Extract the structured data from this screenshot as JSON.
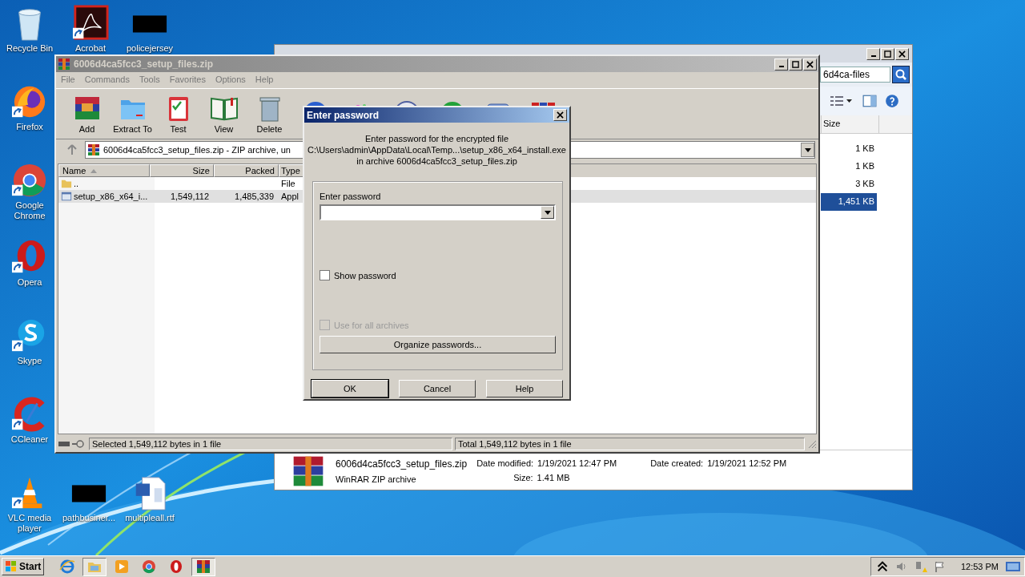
{
  "desktop": {
    "icons": [
      {
        "label": "Recycle Bin",
        "kind": "recycle",
        "shortcut": false
      },
      {
        "label": "Acrobat",
        "kind": "acrobat",
        "shortcut": true
      },
      {
        "label": "policejersey",
        "kind": "blank",
        "shortcut": false
      },
      {
        "label": "Firefox",
        "kind": "firefox",
        "shortcut": true
      },
      {
        "label": "Google Chrome",
        "kind": "chrome",
        "shortcut": true
      },
      {
        "label": "Opera",
        "kind": "opera",
        "shortcut": true
      },
      {
        "label": "Skype",
        "kind": "skype",
        "shortcut": true
      },
      {
        "label": "CCleaner",
        "kind": "ccleaner",
        "shortcut": true
      },
      {
        "label": "VLC media player",
        "kind": "vlc",
        "shortcut": true
      },
      {
        "label": "pathbusiner...",
        "kind": "blank",
        "shortcut": false
      },
      {
        "label": "multipleall.rtf",
        "kind": "word",
        "shortcut": false
      }
    ]
  },
  "explorer": {
    "search": {
      "value": "6d4ca-files"
    },
    "columns": [
      "Size"
    ],
    "rows": [
      {
        "size": "1 KB",
        "selected": false
      },
      {
        "size": "1 KB",
        "selected": false
      },
      {
        "size": "3 KB",
        "selected": false
      },
      {
        "size": "1,451 KB",
        "selected": true
      }
    ],
    "details": {
      "name": "6006d4ca5fcc3_setup_files.zip",
      "type": "WinRAR ZIP archive",
      "modified_label": "Date modified:",
      "modified": "1/19/2021 12:47 PM",
      "created_label": "Date created:",
      "created": "1/19/2021 12:52 PM",
      "size_label": "Size:",
      "size": "1.41 MB"
    }
  },
  "winrar": {
    "title": "6006d4ca5fcc3_setup_files.zip",
    "menu": [
      "File",
      "Commands",
      "Tools",
      "Favorites",
      "Options",
      "Help"
    ],
    "toolbar": [
      {
        "label": "Add",
        "kind": "add"
      },
      {
        "label": "Extract To",
        "kind": "extract"
      },
      {
        "label": "Test",
        "kind": "test"
      },
      {
        "label": "View",
        "kind": "view"
      },
      {
        "label": "Delete",
        "kind": "delete"
      },
      {
        "kind": "find"
      },
      {
        "kind": "wizard"
      },
      {
        "kind": "info"
      },
      {
        "kind": "virus"
      },
      {
        "kind": "comment"
      },
      {
        "kind": "sfx"
      }
    ],
    "address": "6006d4ca5fcc3_setup_files.zip - ZIP archive, un",
    "columns": [
      "Name",
      "Size",
      "Packed",
      "Type"
    ],
    "rows": [
      {
        "kind": "folder",
        "name": "..",
        "type": "File",
        "selected": false
      },
      {
        "kind": "exe",
        "name": "setup_x86_x64_i...",
        "size": "1,549,112",
        "packed": "1,485,339",
        "type": "Appl",
        "selected": true
      }
    ],
    "status_left": "Selected 1,549,112 bytes in 1 file",
    "status_right": "Total 1,549,112 bytes in 1 file"
  },
  "dialog": {
    "title": "Enter password",
    "message": [
      "Enter password for the encrypted file",
      "C:\\Users\\admin\\AppData\\Local\\Temp...\\setup_x86_x64_install.exe",
      "in archive 6006d4ca5fcc3_setup_files.zip"
    ],
    "password_label": "Enter password",
    "show_password": {
      "label": "Show password",
      "checked": false,
      "disabled": false
    },
    "use_for_all": {
      "label": "Use for all archives",
      "checked": false,
      "disabled": true
    },
    "organize": "Organize passwords...",
    "buttons": [
      "OK",
      "Cancel",
      "Help"
    ]
  },
  "taskbar": {
    "start": "Start",
    "apps": [
      {
        "kind": "ie",
        "active": false
      },
      {
        "kind": "explorer",
        "active": true
      },
      {
        "kind": "media",
        "active": false
      },
      {
        "kind": "chrome",
        "active": false
      },
      {
        "kind": "opera",
        "active": false
      },
      {
        "kind": "winrar",
        "active": true
      }
    ],
    "clock": "12:53 PM"
  }
}
